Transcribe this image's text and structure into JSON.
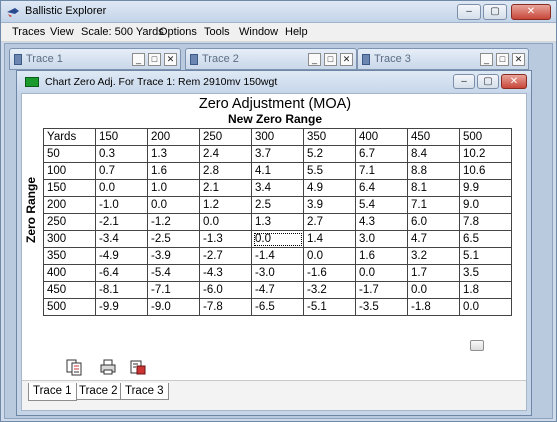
{
  "app": {
    "title": "Ballistic Explorer"
  },
  "menu": [
    {
      "label": "Traces"
    },
    {
      "label": "View"
    },
    {
      "label": "Scale: 500 Yards"
    },
    {
      "label": "Options"
    },
    {
      "label": "Tools"
    },
    {
      "label": "Window"
    },
    {
      "label": "Help"
    }
  ],
  "trace_windows": [
    {
      "title": "Trace 1"
    },
    {
      "title": "Trace 2"
    },
    {
      "title": "Trace 3"
    }
  ],
  "chart_window": {
    "title": "Chart Zero Adj. For Trace 1:  Rem 2910mv 150wgt"
  },
  "table": {
    "title": "Zero Adjustment (MOA)",
    "subtitle": "New Zero Range",
    "row_axis_label": "Zero Range",
    "corner": "Yards",
    "columns": [
      "150",
      "200",
      "250",
      "300",
      "350",
      "400",
      "450",
      "500"
    ],
    "rows": [
      {
        "label": "50",
        "values": [
          "0.3",
          "1.3",
          "2.4",
          "3.7",
          "5.2",
          "6.7",
          "8.4",
          "10.2"
        ]
      },
      {
        "label": "100",
        "values": [
          "0.7",
          "1.6",
          "2.8",
          "4.1",
          "5.5",
          "7.1",
          "8.8",
          "10.6"
        ]
      },
      {
        "label": "150",
        "values": [
          "0.0",
          "1.0",
          "2.1",
          "3.4",
          "4.9",
          "6.4",
          "8.1",
          "9.9"
        ]
      },
      {
        "label": "200",
        "values": [
          "-1.0",
          "0.0",
          "1.2",
          "2.5",
          "3.9",
          "5.4",
          "7.1",
          "9.0"
        ]
      },
      {
        "label": "250",
        "values": [
          "-2.1",
          "-1.2",
          "0.0",
          "1.3",
          "2.7",
          "4.3",
          "6.0",
          "7.8"
        ]
      },
      {
        "label": "300",
        "values": [
          "-3.4",
          "-2.5",
          "-1.3",
          "0.0",
          "1.4",
          "3.0",
          "4.7",
          "6.5"
        ]
      },
      {
        "label": "350",
        "values": [
          "-4.9",
          "-3.9",
          "-2.7",
          "-1.4",
          "0.0",
          "1.6",
          "3.2",
          "5.1"
        ]
      },
      {
        "label": "400",
        "values": [
          "-6.4",
          "-5.4",
          "-4.3",
          "-3.0",
          "-1.6",
          "0.0",
          "1.7",
          "3.5"
        ]
      },
      {
        "label": "450",
        "values": [
          "-8.1",
          "-7.1",
          "-6.0",
          "-4.7",
          "-3.2",
          "-1.7",
          "0.0",
          "1.8"
        ]
      },
      {
        "label": "500",
        "values": [
          "-9.9",
          "-9.0",
          "-7.8",
          "-6.5",
          "-5.1",
          "-3.5",
          "-1.8",
          "0.0"
        ]
      }
    ]
  },
  "tabs": [
    {
      "label": "Trace 1",
      "active": true
    },
    {
      "label": "Trace 2",
      "active": false
    },
    {
      "label": "Trace 3",
      "active": false
    }
  ],
  "icons": {
    "app": "crosshair-bullet-icon",
    "toolbar": [
      "copy-table-icon",
      "print-icon",
      "export-icon"
    ]
  },
  "colors": {
    "chart_icon": "#1a9a2d",
    "close_button": "#c7473a"
  }
}
